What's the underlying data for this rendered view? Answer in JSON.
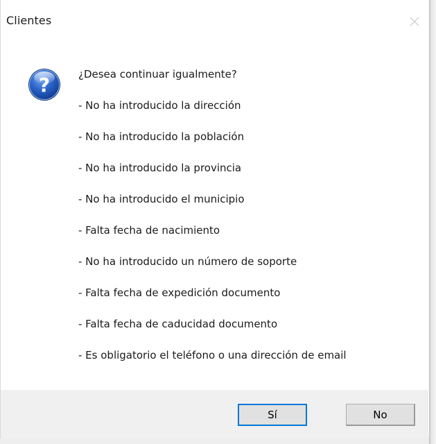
{
  "window": {
    "title": "Clientes",
    "close_icon": "close-icon"
  },
  "message": {
    "icon": "question-icon",
    "question": "¿Desea continuar igualmente?",
    "lines": [
      "- No ha introducido la dirección",
      "- No ha introducido la población",
      "- No ha introducido la provincia",
      "- No ha introducido el municipio",
      "- Falta fecha de nacimiento",
      "- No ha introducido un número de soporte",
      "- Falta fecha de expedición documento",
      "- Falta fecha de caducidad documento",
      "- Es obligatorio el teléfono o una dirección de email"
    ]
  },
  "buttons": {
    "yes_label": "Sí",
    "no_label": "No"
  },
  "colors": {
    "focus_border": "#0078d7",
    "footer_bg": "#f0f0f0",
    "icon_blue": "#1f5fbf"
  }
}
